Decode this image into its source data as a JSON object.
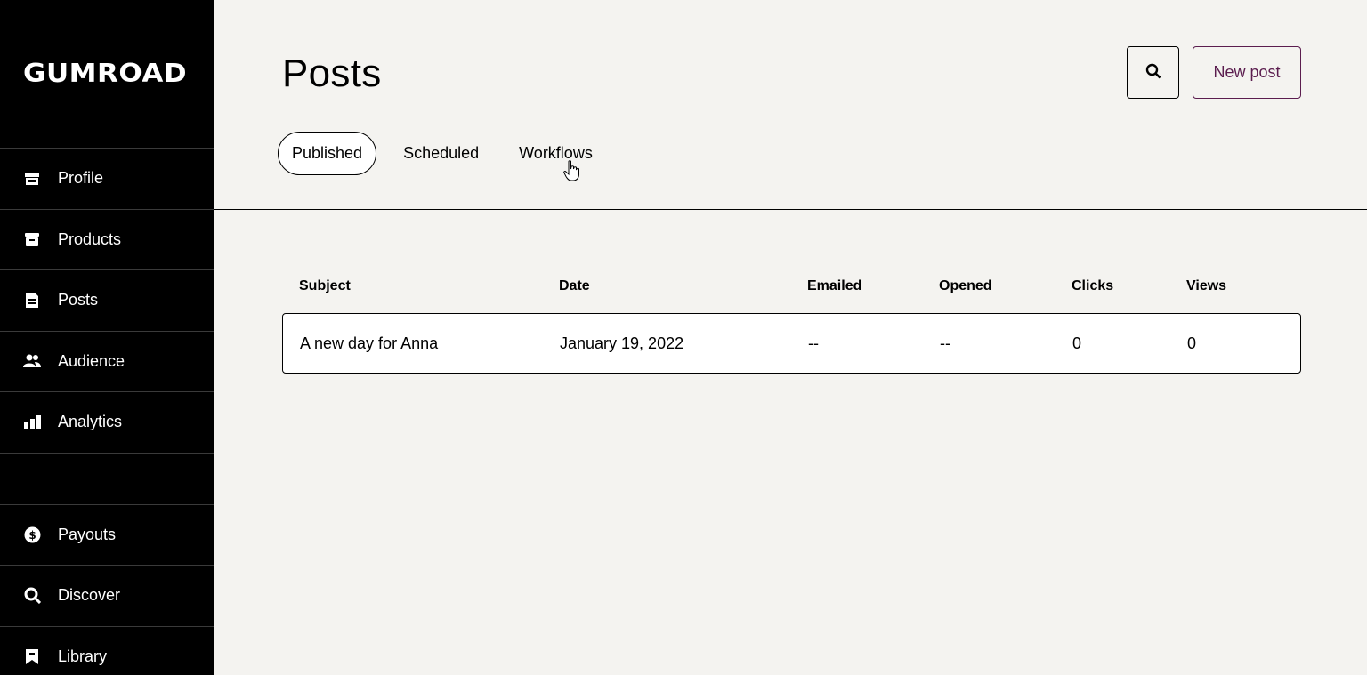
{
  "brand": {
    "logo_text": "GUMROAD"
  },
  "sidebar": {
    "items": [
      {
        "label": "Profile",
        "icon": "store-icon"
      },
      {
        "label": "Products",
        "icon": "archive-box-icon"
      },
      {
        "label": "Posts",
        "icon": "document-icon"
      },
      {
        "label": "Audience",
        "icon": "people-icon"
      },
      {
        "label": "Analytics",
        "icon": "bar-chart-icon"
      }
    ],
    "bottom_items": [
      {
        "label": "Payouts",
        "icon": "dollar-circle-icon"
      },
      {
        "label": "Discover",
        "icon": "search-icon"
      },
      {
        "label": "Library",
        "icon": "bookmark-icon"
      }
    ]
  },
  "header": {
    "title": "Posts",
    "new_post_label": "New post",
    "tabs": [
      {
        "label": "Published",
        "active": true
      },
      {
        "label": "Scheduled",
        "active": false
      },
      {
        "label": "Workflows",
        "active": false
      }
    ]
  },
  "table": {
    "columns": [
      "Subject",
      "Date",
      "Emailed",
      "Opened",
      "Clicks",
      "Views"
    ],
    "rows": [
      {
        "subject": "A new day for Anna",
        "date": "January 19, 2022",
        "emailed": "--",
        "opened": "--",
        "clicks": "0",
        "views": "0"
      }
    ]
  },
  "colors": {
    "accent": "#5b1d4f",
    "sidebar_bg": "#000000",
    "page_bg": "#f4f3f0"
  }
}
